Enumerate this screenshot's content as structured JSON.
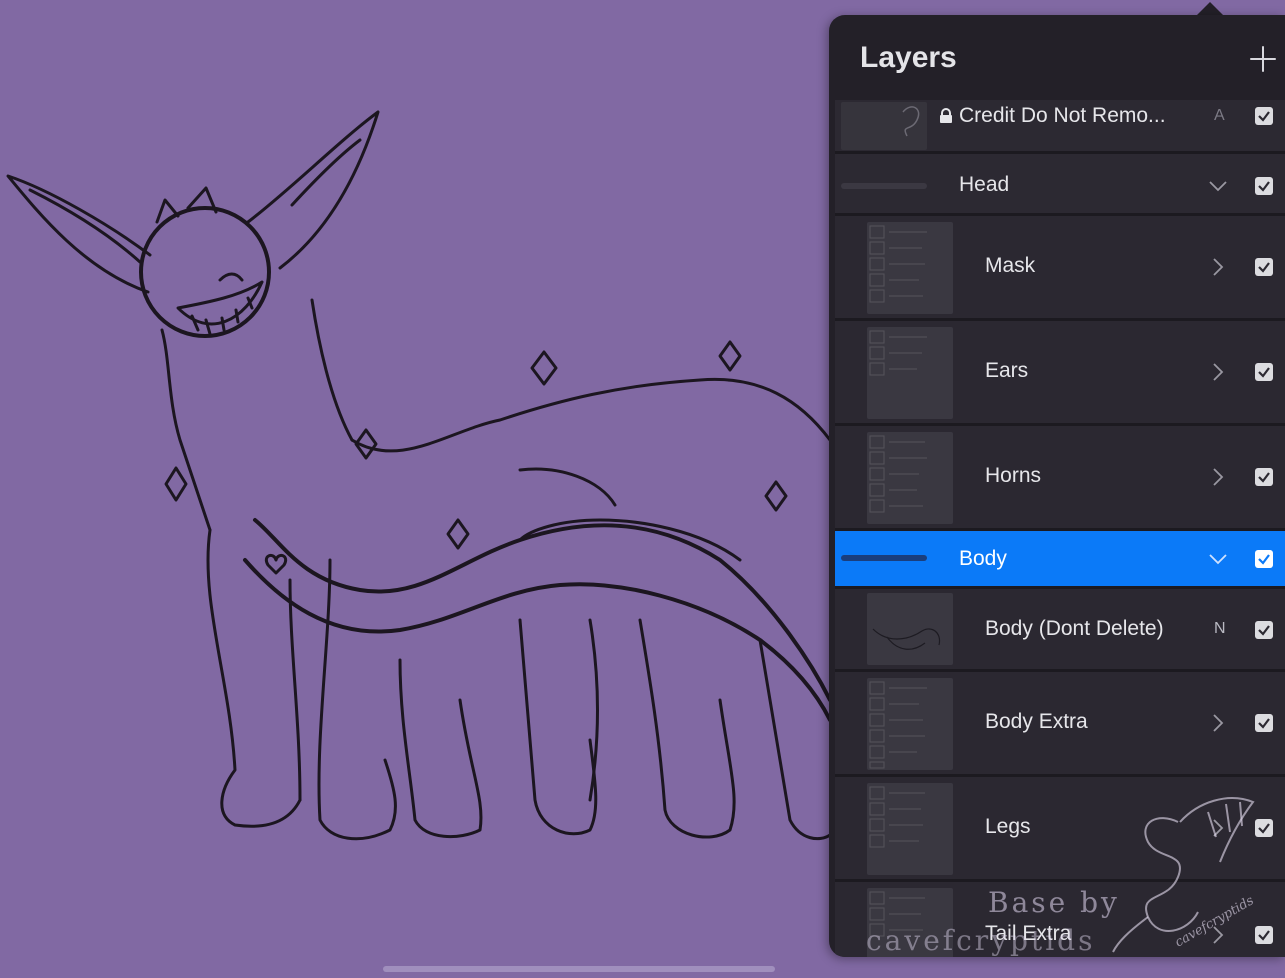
{
  "panel": {
    "title": "Layers",
    "add_icon": "plus-icon"
  },
  "layers": [
    {
      "label": "Credit Do Not Remo...",
      "mode": "A",
      "locked": true,
      "visible": true
    },
    {
      "label": "Head",
      "type": "group",
      "expanded": true,
      "visible": true
    },
    {
      "label": "Mask",
      "type": "group",
      "expanded": false,
      "visible": true
    },
    {
      "label": "Ears",
      "type": "group",
      "expanded": false,
      "visible": true
    },
    {
      "label": "Horns",
      "type": "group",
      "expanded": false,
      "visible": true
    },
    {
      "label": "Body",
      "type": "group",
      "expanded": true,
      "selected": true,
      "visible": true
    },
    {
      "label": "Body (Dont Delete)",
      "mode": "N",
      "visible": true
    },
    {
      "label": "Body Extra",
      "type": "group",
      "expanded": false,
      "visible": true
    },
    {
      "label": "Legs",
      "type": "group",
      "expanded": false,
      "visible": true
    },
    {
      "label": "Tail Extra",
      "type": "group",
      "expanded": false,
      "visible": true
    }
  ],
  "watermark": {
    "line1": "Base by",
    "line2": "cavefcryptids"
  },
  "colors": {
    "canvas_background": "#8169a3",
    "panel_background": "#232028",
    "selection_accent": "#0b7af8"
  }
}
